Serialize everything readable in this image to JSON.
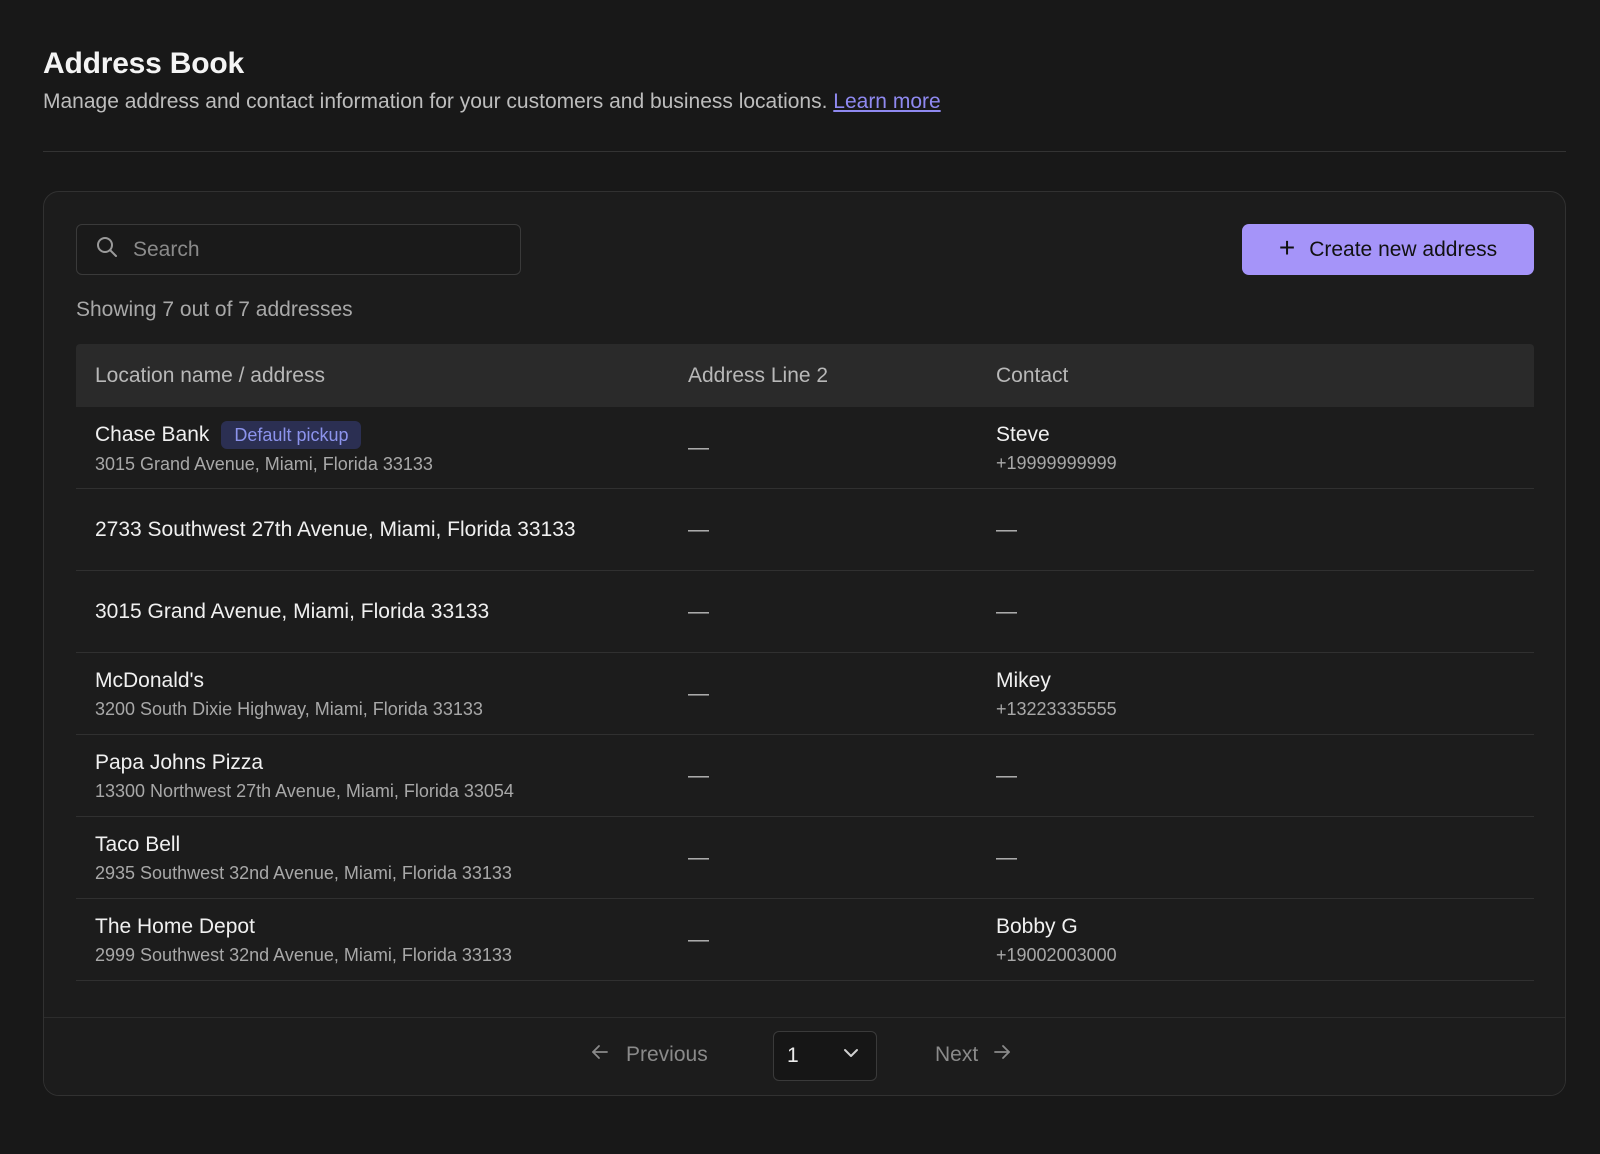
{
  "header": {
    "title": "Address Book",
    "subtitle": "Manage address and contact information for your customers and business locations.",
    "learn_more": "Learn more"
  },
  "toolbar": {
    "search_placeholder": "Search",
    "create_label": "Create new address",
    "count_text": "Showing 7 out of 7 addresses"
  },
  "table": {
    "columns": [
      "Location name / address",
      "Address Line 2",
      "Contact"
    ],
    "rows": [
      {
        "name": "Chase Bank",
        "badge": "Default pickup",
        "address": "3015 Grand Avenue, Miami, Florida 33133",
        "line2": "—",
        "contact_name": "Steve",
        "contact_phone": "+19999999999"
      },
      {
        "name": "2733 Southwest 27th Avenue, Miami, Florida 33133",
        "badge": "",
        "address": "",
        "line2": "—",
        "contact_name": "—",
        "contact_phone": ""
      },
      {
        "name": "3015 Grand Avenue, Miami, Florida 33133",
        "badge": "",
        "address": "",
        "line2": "—",
        "contact_name": "—",
        "contact_phone": ""
      },
      {
        "name": "McDonald's",
        "badge": "",
        "address": "3200 South Dixie Highway, Miami, Florida 33133",
        "line2": "—",
        "contact_name": "Mikey",
        "contact_phone": "+13223335555"
      },
      {
        "name": "Papa Johns Pizza",
        "badge": "",
        "address": "13300 Northwest 27th Avenue, Miami, Florida 33054",
        "line2": "—",
        "contact_name": "—",
        "contact_phone": ""
      },
      {
        "name": "Taco Bell",
        "badge": "",
        "address": "2935 Southwest 32nd Avenue, Miami, Florida 33133",
        "line2": "—",
        "contact_name": "—",
        "contact_phone": ""
      },
      {
        "name": "The Home Depot",
        "badge": "",
        "address": "2999 Southwest 32nd Avenue, Miami, Florida 33133",
        "line2": "—",
        "contact_name": "Bobby G",
        "contact_phone": "+19002003000"
      }
    ]
  },
  "pagination": {
    "previous_label": "Previous",
    "next_label": "Next",
    "current_page": "1"
  },
  "colors": {
    "accent": "#a594f9",
    "link": "#8f89f0",
    "background": "#181818"
  },
  "icons": {
    "search": "search-icon",
    "plus": "plus-icon",
    "prev": "arrow-left-icon",
    "next": "arrow-right-icon",
    "dropdown": "chevron-down-icon"
  }
}
